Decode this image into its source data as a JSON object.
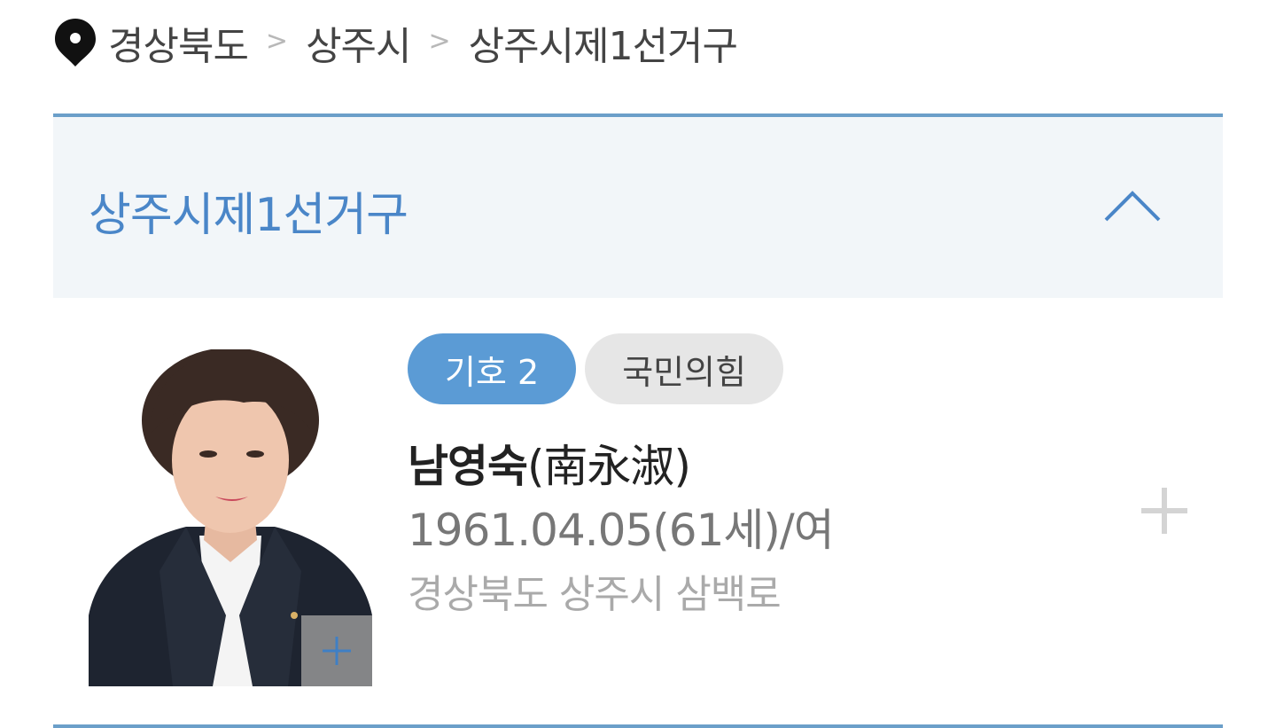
{
  "breadcrumb": {
    "items": [
      "경상북도",
      "상주시",
      "상주시제1선거구"
    ],
    "separator": ">"
  },
  "section": {
    "title": "상주시제1선거구",
    "accent_color": "#4a86c8",
    "border_color": "#6b9fc9",
    "toggle_icon": "chevron-up-icon"
  },
  "candidate": {
    "number_badge": "기호 2",
    "party_badge": "국민의힘",
    "name": "남영숙",
    "name_hanja": "(南永淑)",
    "birth_info": "1961.04.05(61세)/여",
    "address": "경상북도 상주시 삼백로",
    "number_badge_color": "#5b9bd5",
    "party_badge_color": "#e6e6e6",
    "expand_icon": "plus-icon",
    "photo_enlarge_icon": "plus-icon"
  }
}
